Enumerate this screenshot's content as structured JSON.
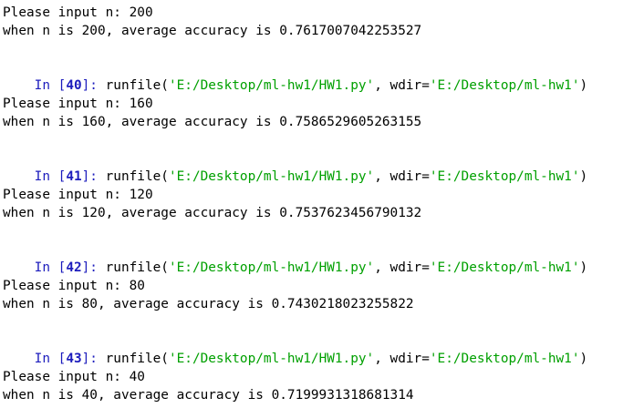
{
  "colors": {
    "prompt": "#1d1dbd",
    "string": "#00a000",
    "text": "#000000",
    "background": "#ffffff"
  },
  "console": {
    "first_block": {
      "input_line": "Please input n: 200",
      "result_line": "when n is 200, average accuracy is 0.7617007042253527"
    },
    "cells": [
      {
        "prompt_in": "In [",
        "prompt_num": "40",
        "prompt_end": "]: ",
        "call_open": "runfile(",
        "path_arg": "'E:/Desktop/ml-hw1/HW1.py'",
        "sep_kw": ", wdir=",
        "wdir_arg": "'E:/Desktop/ml-hw1'",
        "call_close": ")",
        "input_line": "Please input n: 160",
        "result_line": "when n is 160, average accuracy is 0.7586529605263155"
      },
      {
        "prompt_in": "In [",
        "prompt_num": "41",
        "prompt_end": "]: ",
        "call_open": "runfile(",
        "path_arg": "'E:/Desktop/ml-hw1/HW1.py'",
        "sep_kw": ", wdir=",
        "wdir_arg": "'E:/Desktop/ml-hw1'",
        "call_close": ")",
        "input_line": "Please input n: 120",
        "result_line": "when n is 120, average accuracy is 0.7537623456790132"
      },
      {
        "prompt_in": "In [",
        "prompt_num": "42",
        "prompt_end": "]: ",
        "call_open": "runfile(",
        "path_arg": "'E:/Desktop/ml-hw1/HW1.py'",
        "sep_kw": ", wdir=",
        "wdir_arg": "'E:/Desktop/ml-hw1'",
        "call_close": ")",
        "input_line": "Please input n: 80",
        "result_line": "when n is 80, average accuracy is 0.7430218023255822"
      },
      {
        "prompt_in": "In [",
        "prompt_num": "43",
        "prompt_end": "]: ",
        "call_open": "runfile(",
        "path_arg": "'E:/Desktop/ml-hw1/HW1.py'",
        "sep_kw": ", wdir=",
        "wdir_arg": "'E:/Desktop/ml-hw1'",
        "call_close": ")",
        "input_line": "Please input n: 40",
        "result_line": "when n is 40, average accuracy is 0.7199931318681314"
      }
    ]
  }
}
